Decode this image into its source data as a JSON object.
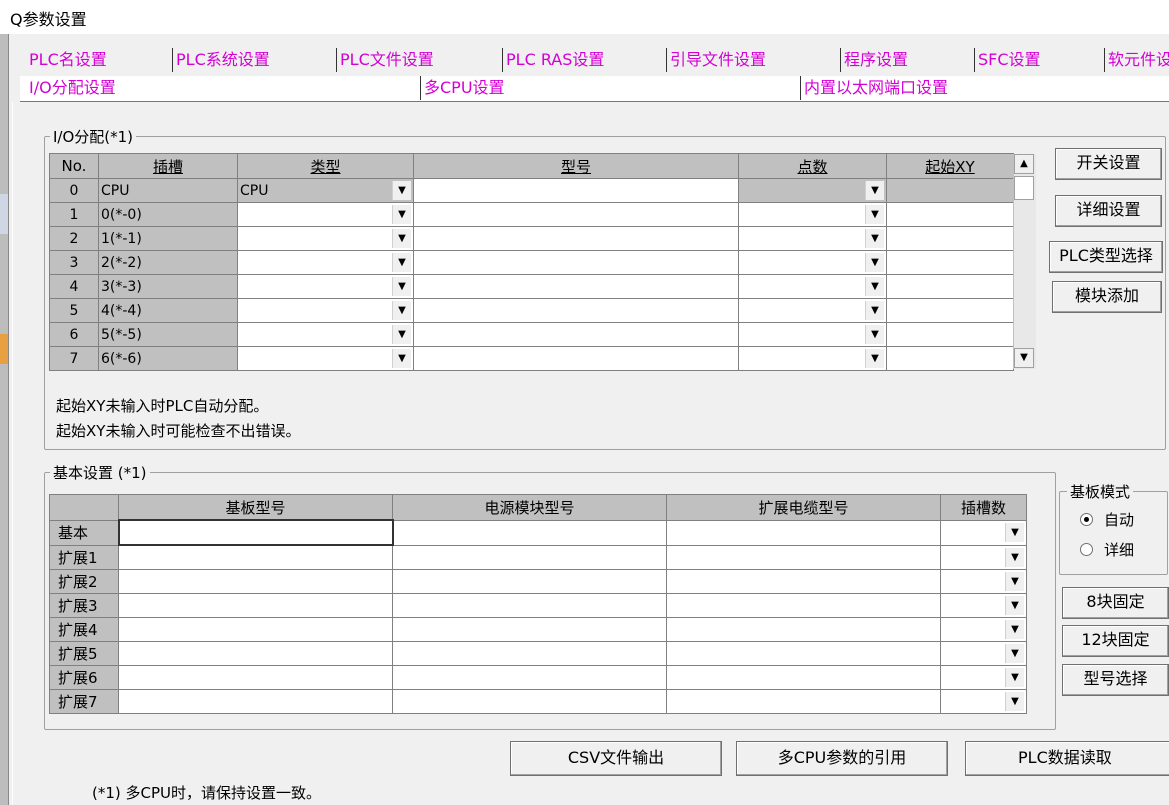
{
  "window": {
    "title": "Q参数设置"
  },
  "tabs": {
    "row1": [
      "PLC名设置",
      "PLC系统设置",
      "PLC文件设置",
      "PLC RAS设置",
      "引导文件设置",
      "程序设置",
      "SFC设置",
      "软元件设"
    ],
    "row2": [
      "I/O分配设置",
      "多CPU设置",
      "内置以太网端口设置"
    ]
  },
  "io": {
    "group_label": "I/O分配(*1)",
    "headers": [
      "No.",
      "插槽",
      "类型",
      "型号",
      "点数",
      "起始XY"
    ],
    "rows": [
      {
        "no": "0",
        "slot": "CPU",
        "type": "CPU"
      },
      {
        "no": "1",
        "slot": "0(*-0)",
        "type": ""
      },
      {
        "no": "2",
        "slot": "1(*-1)",
        "type": ""
      },
      {
        "no": "3",
        "slot": "2(*-2)",
        "type": ""
      },
      {
        "no": "4",
        "slot": "3(*-3)",
        "type": ""
      },
      {
        "no": "5",
        "slot": "4(*-4)",
        "type": ""
      },
      {
        "no": "6",
        "slot": "5(*-5)",
        "type": ""
      },
      {
        "no": "7",
        "slot": "6(*-6)",
        "type": ""
      }
    ],
    "note1": "起始XY未输入时PLC自动分配。",
    "note2": "起始XY未输入时可能检查不出错误。",
    "buttons": [
      "开关设置",
      "详细设置",
      "PLC类型选择",
      "模块添加"
    ]
  },
  "base": {
    "group_label": "基本设置 (*1)",
    "headers": [
      "",
      "基板型号",
      "电源模块型号",
      "扩展电缆型号",
      "插槽数"
    ],
    "rows": [
      "基本",
      "扩展1",
      "扩展2",
      "扩展3",
      "扩展4",
      "扩展5",
      "扩展6",
      "扩展7"
    ],
    "mode_label": "基板模式",
    "mode_auto": "自动",
    "mode_detail": "详细",
    "buttons": [
      "8块固定",
      "12块固定",
      "型号选择"
    ]
  },
  "bottom": {
    "buttons": [
      "CSV文件输出",
      "多CPU参数的引用",
      "PLC数据读取"
    ],
    "footnote": "(*1) 多CPU时，请保持设置一致。"
  }
}
